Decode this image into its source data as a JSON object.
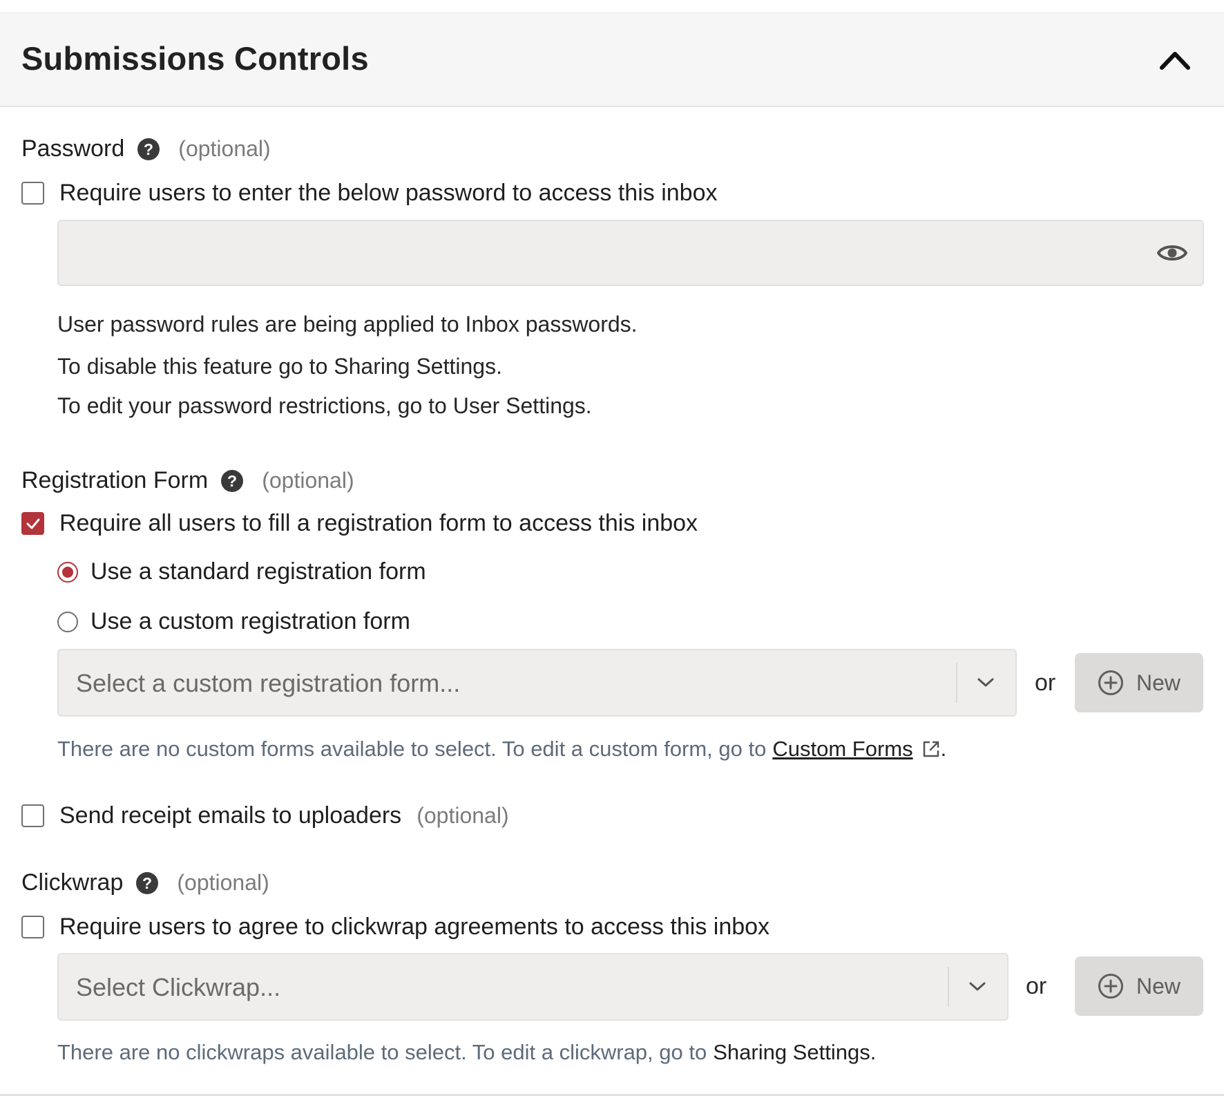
{
  "header": {
    "title": "Submissions Controls"
  },
  "password": {
    "label": "Password",
    "optional": "(optional)",
    "checkbox_label": "Require users to enter the below password to access this inbox",
    "checked": false,
    "field_value": "",
    "info": [
      "User password rules are being applied to Inbox passwords.",
      "To disable this feature go to Sharing Settings.",
      "To edit your password restrictions, go to User Settings."
    ]
  },
  "registration": {
    "label": "Registration Form",
    "optional": "(optional)",
    "checkbox_label": "Require all users to fill a registration form to access this inbox",
    "checked": true,
    "radio_standard": "Use a standard registration form",
    "radio_custom": "Use a custom registration form",
    "selected_radio": "standard",
    "select_placeholder": "Select a custom registration form...",
    "or": "or",
    "new_label": "New",
    "hint_text": "There are no custom forms available to select. To edit a custom form, go to",
    "hint_link": "Custom Forms",
    "hint_end": "."
  },
  "receipt": {
    "checkbox_label": "Send receipt emails to uploaders",
    "optional": "(optional)",
    "checked": false
  },
  "clickwrap": {
    "label": "Clickwrap",
    "optional": "(optional)",
    "checkbox_label": "Require users to agree to clickwrap agreements to access this inbox",
    "checked": false,
    "select_placeholder": "Select Clickwrap...",
    "or": "or",
    "new_label": "New",
    "hint_text": "There are no clickwraps available to select. To edit a clickwrap, go to",
    "hint_link": "Sharing Settings",
    "hint_end": "."
  },
  "colors": {
    "accent": "#b3343a",
    "field_bg": "#efeeed",
    "button_bg": "#dcdbd9",
    "hint": "#5d6b7a"
  },
  "icons": {
    "collapse": "chevron-up-icon",
    "help": "question-circle-icon",
    "eye": "eye-icon",
    "chevron": "chevron-down-icon",
    "plus": "plus-circle-icon",
    "external": "external-link-icon",
    "check": "check-icon"
  }
}
